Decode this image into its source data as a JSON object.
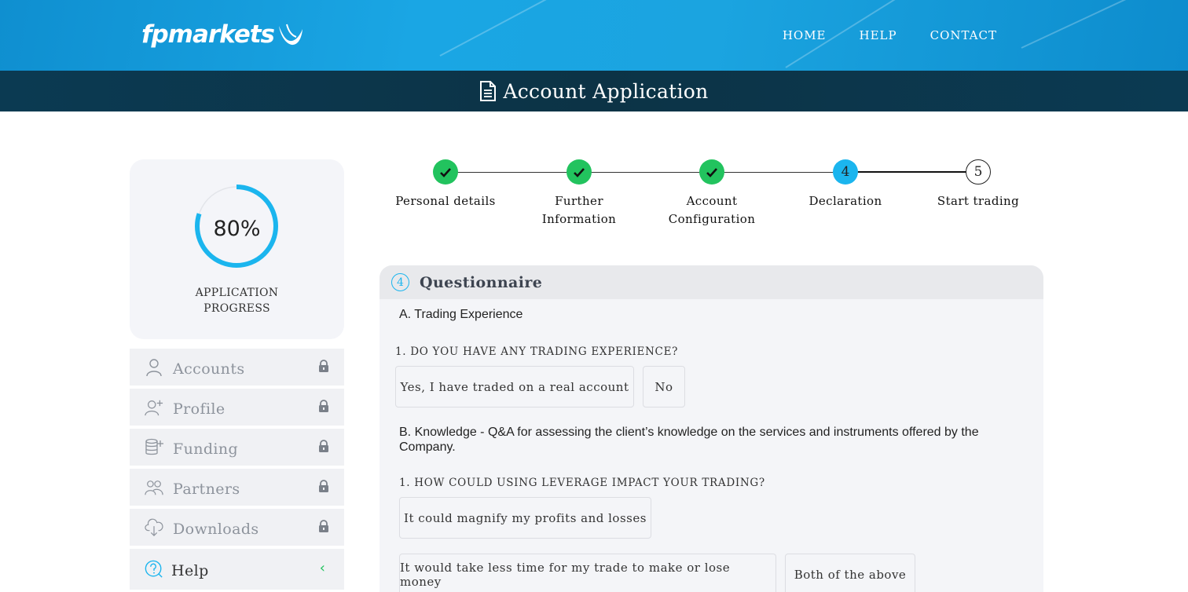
{
  "brand": {
    "name": "fpmarkets"
  },
  "nav": {
    "home": "HOME",
    "help": "HELP",
    "contact": "CONTACT"
  },
  "page": {
    "title": "Account Application"
  },
  "progress": {
    "value": 0.8,
    "label_value": "80%",
    "label_line1": "APPLICATION",
    "label_line2": "PROGRESS",
    "color": "#1bb5ee"
  },
  "sidebar": {
    "items": [
      {
        "label": "Accounts",
        "icon": "user-icon",
        "locked": true
      },
      {
        "label": "Profile",
        "icon": "add-user-icon",
        "locked": true
      },
      {
        "label": "Funding",
        "icon": "coins-icon",
        "locked": true
      },
      {
        "label": "Partners",
        "icon": "users-icon",
        "locked": true
      },
      {
        "label": "Downloads",
        "icon": "cloud-download-icon",
        "locked": true
      }
    ],
    "help": {
      "label": "Help",
      "icon": "question-icon",
      "chevron": "‹"
    }
  },
  "steps": [
    {
      "label_line1": "Personal details",
      "label_line2": "",
      "status": "done",
      "number": "1"
    },
    {
      "label_line1": "Further Information",
      "label_line2": "",
      "status": "done",
      "number": "2"
    },
    {
      "label_line1": "Account",
      "label_line2": "Configuration",
      "status": "done",
      "number": "3"
    },
    {
      "label_line1": "Declaration",
      "label_line2": "",
      "status": "current",
      "number": "4"
    },
    {
      "label_line1": "Start trading",
      "label_line2": "",
      "status": "todo",
      "number": "5"
    }
  ],
  "questionnaire": {
    "number": "4",
    "title": "Questionnaire",
    "section_a": "A. Trading Experience",
    "q_a1": "1. DO YOU HAVE ANY TRADING EXPERIENCE?",
    "q_a1_options": [
      "Yes, I have traded on a real account",
      "No"
    ],
    "section_b_line1": "B. Knowledge - Q&A for assessing the client’s knowledge on the services and instruments offered by the",
    "section_b_line2": "Company.",
    "q_b1": "1. HOW COULD USING LEVERAGE IMPACT YOUR TRADING?",
    "q_b1_options": [
      "It could magnify my profits and losses",
      "It would take less time for my trade to make or lose money",
      "Both of the above"
    ]
  },
  "colors": {
    "accent": "#1bb5ee",
    "success": "#22c35e",
    "header": "#1aa6e4",
    "titlebar": "#0c3346"
  }
}
